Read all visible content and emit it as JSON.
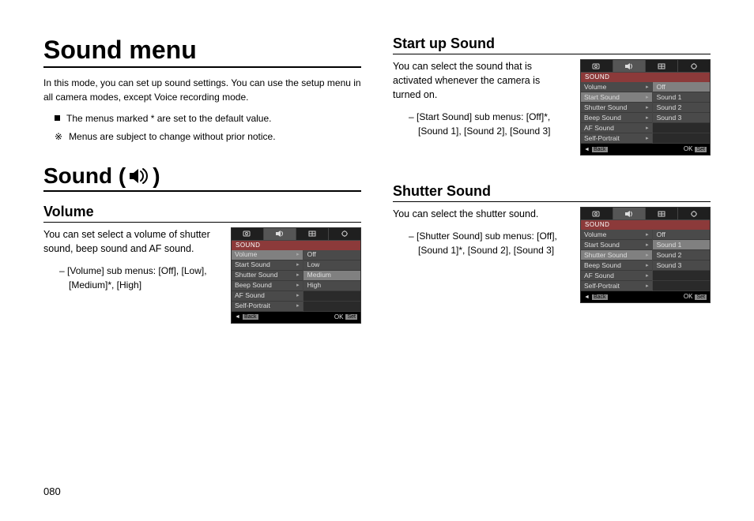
{
  "page_title": "Sound menu",
  "intro": "In this mode, you can set up sound settings. You can use the setup menu in all camera modes, except Voice recording mode.",
  "notes": {
    "n1": "The menus marked * are set to the default value.",
    "n2": "Menus are subject to change without prior notice."
  },
  "section2_title_pre": "Sound (",
  "section2_title_post": ")",
  "page_number": "080",
  "volume": {
    "title": "Volume",
    "desc": "You can set select a volume of shutter sound, beep sound and AF sound.",
    "detail": "[Volume] sub menus: [Off], [Low], [Medium]*, [High]",
    "lcd": {
      "header": "SOUND",
      "menu": [
        "Volume",
        "Start Sound",
        "Shutter Sound",
        "Beep Sound",
        "AF Sound",
        "Self-Portrait"
      ],
      "menu_sel": 0,
      "options": [
        "Off",
        "Low",
        "Medium",
        "High"
      ],
      "opt_sel": 2,
      "back": "Back",
      "ok": "OK",
      "set": "Set"
    }
  },
  "startup": {
    "title": "Start up Sound",
    "desc": "You can select the sound that is activated whenever the camera is turned on.",
    "detail": "[Start Sound] sub menus: [Off]*, [Sound 1], [Sound 2], [Sound 3]",
    "lcd": {
      "header": "SOUND",
      "menu": [
        "Volume",
        "Start Sound",
        "Shutter Sound",
        "Beep Sound",
        "AF Sound",
        "Self-Portrait"
      ],
      "menu_sel": 1,
      "options": [
        "Off",
        "Sound 1",
        "Sound 2",
        "Sound 3"
      ],
      "opt_sel": 0,
      "back": "Back",
      "ok": "OK",
      "set": "Set"
    }
  },
  "shutter": {
    "title": "Shutter Sound",
    "desc": "You can select the shutter sound.",
    "detail": "[Shutter Sound] sub menus: [Off], [Sound 1]*, [Sound 2], [Sound 3]",
    "lcd": {
      "header": "SOUND",
      "menu": [
        "Volume",
        "Start Sound",
        "Shutter Sound",
        "Beep Sound",
        "AF Sound",
        "Self-Portrait"
      ],
      "menu_sel": 2,
      "options": [
        "Off",
        "Sound 1",
        "Sound 2",
        "Sound 3"
      ],
      "opt_sel": 1,
      "back": "Back",
      "ok": "OK",
      "set": "Set"
    }
  }
}
